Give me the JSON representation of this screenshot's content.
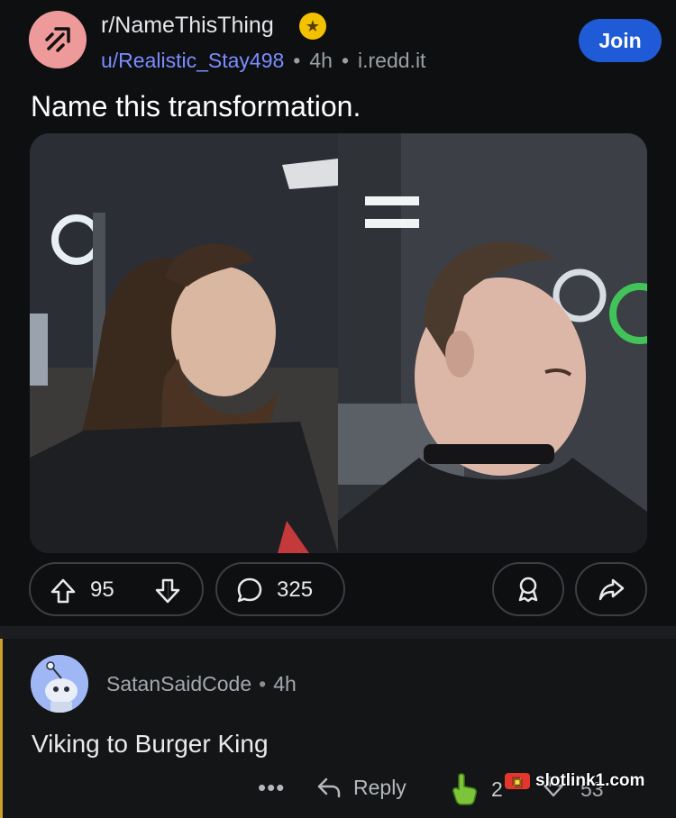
{
  "post": {
    "subreddit": "r/NameThisThing",
    "author": "u/Realistic_Stay498",
    "time": "4h",
    "domain": "i.redd.it",
    "join_label": "Join",
    "title": "Name this transformation.",
    "image_description_icons": [
      "before-photo",
      "after-photo"
    ],
    "upvotes": "95",
    "comments": "325"
  },
  "comment": {
    "username": "SatanSaidCode",
    "time": "4h",
    "body": "Viking to Burger King",
    "more_label": "•••",
    "reply_label": "Reply",
    "votes": "2",
    "partial_count": "53"
  },
  "watermark": {
    "text": "slotlink1.com"
  },
  "colors": {
    "join": "#1f5bd6",
    "username_link": "#7a8cff",
    "subreddit_avatar": "#ef9a9a",
    "badge": "#f2c200",
    "thread_line": "#c9a227"
  }
}
